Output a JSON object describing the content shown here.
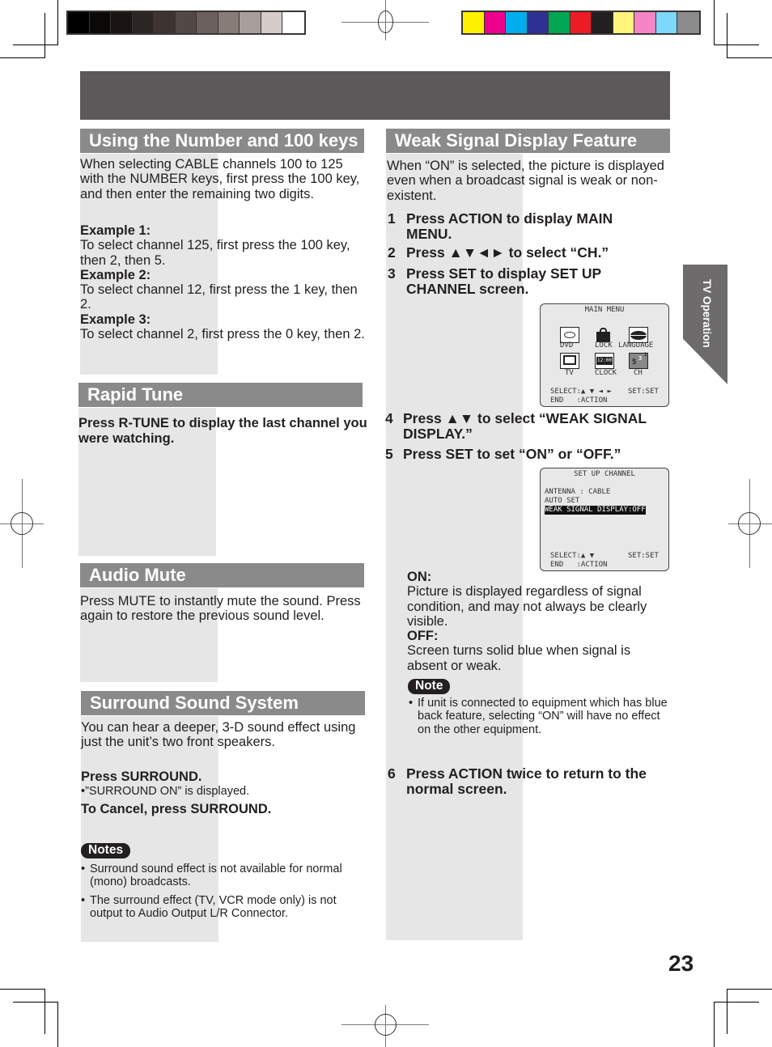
{
  "colors": {
    "grayscale_swatches": [
      "#000000",
      "#0b0908",
      "#1a1514",
      "#2a2422",
      "#3d3432",
      "#524845",
      "#6b605d",
      "#877c78",
      "#a79f9c",
      "#d5cccb",
      "#ffffff"
    ],
    "process_swatches": [
      "#fff200",
      "#ec008c",
      "#00aeef",
      "#2e3192",
      "#00a651",
      "#ed1c24",
      "#231f20",
      "#fff57d",
      "#f585c4",
      "#7dd8f9",
      "#8c8c8c"
    ],
    "header_band": "#5b5959",
    "section_header": "#8b8a8a",
    "shade": "#e6e6e6",
    "side_tab": "#6d6b6b"
  },
  "side_tab": {
    "label": "TV Operation"
  },
  "page_number": "23",
  "left": {
    "number_keys": {
      "title": "Using the Number and 100 keys",
      "intro": "When selecting CABLE channels 100 to 125 with the NUMBER keys, first press the 100 key, and then enter the remaining two digits.",
      "examples": [
        {
          "label": "Example 1:",
          "text": "To select channel 125, first press the 100 key, then 2, then 5."
        },
        {
          "label": "Example 2:",
          "text": "To select channel 12, first press the 1 key, then 2."
        },
        {
          "label": "Example 3:",
          "text": "To select channel 2, first press the 0 key, then 2."
        }
      ]
    },
    "rapid_tune": {
      "title": "Rapid Tune",
      "text": "Press R-TUNE to display the last channel you were watching."
    },
    "audio_mute": {
      "title": "Audio Mute",
      "text": "Press MUTE to instantly mute the sound. Press again to restore the previous sound level."
    },
    "surround": {
      "title": "Surround Sound System",
      "intro": "You can hear a deeper, 3-D sound effect using just the unit’s two front speakers.",
      "press": "Press SURROUND.",
      "displayed": "•”SURROUND ON” is displayed.",
      "cancel": "To Cancel, press SURROUND.",
      "notes_label": "Notes",
      "notes": [
        "Surround sound effect is not available for normal (mono) broadcasts.",
        "The surround effect (TV, VCR mode only) is not output to Audio Output L/R Connector."
      ]
    }
  },
  "right": {
    "title": "Weak Signal Display Feature",
    "intro": "When “ON” is selected, the picture is displayed even when a broadcast signal is weak or non-existent.",
    "steps": [
      {
        "num": "1",
        "text": "Press ACTION to display MAIN MENU."
      },
      {
        "num": "2",
        "text": "Press ▲▼◄► to select “CH.”"
      },
      {
        "num": "3",
        "text": "Press SET to display SET UP CHANNEL screen."
      },
      {
        "num": "4",
        "text": "Press ▲▼ to select “WEAK SIGNAL DISPLAY.”"
      },
      {
        "num": "5",
        "text": "Press SET to set “ON” or “OFF.”"
      },
      {
        "num": "6",
        "text": "Press ACTION twice to return to the normal screen."
      }
    ],
    "main_menu_screen": {
      "title": "MAIN MENU",
      "items": [
        {
          "label": "DVD",
          "icon": "disc-icon"
        },
        {
          "label": "LOCK",
          "icon": "lock-icon"
        },
        {
          "label": "LANGUAGE",
          "icon": "lips-icon"
        },
        {
          "label": "TV",
          "icon": "tv-icon"
        },
        {
          "label": "CLOCK",
          "icon": "clock-icon"
        },
        {
          "label": "CH",
          "icon": "channel-icon"
        }
      ],
      "ch_icon_text": "5",
      "ch_icon_sup1": "3",
      "ch_icon_sup2": "1",
      "clock_icon_text": "12:00",
      "footer_select": "SELECT:▲ ▼ ◄ ►",
      "footer_set": "SET:SET",
      "footer_end": "END   :ACTION"
    },
    "setup_channel_screen": {
      "title": "SET UP CHANNEL",
      "lines": [
        "ANTENNA : CABLE",
        "AUTO SET"
      ],
      "highlighted": "WEAK SIGNAL DISPLAY:OFF",
      "footer_select": "SELECT:▲ ▼",
      "footer_set": "SET:SET",
      "footer_end": "END   :ACTION"
    },
    "options": {
      "on_label": "ON:",
      "on_text": "Picture is displayed regardless of signal condition, and may not always be clearly visible.",
      "off_label": "OFF:",
      "off_text": "Screen turns solid blue when signal is absent or weak."
    },
    "note_label": "Note",
    "note": "If unit is connected to equipment which has blue back feature, selecting “ON” will have no effect on the other equipment."
  }
}
